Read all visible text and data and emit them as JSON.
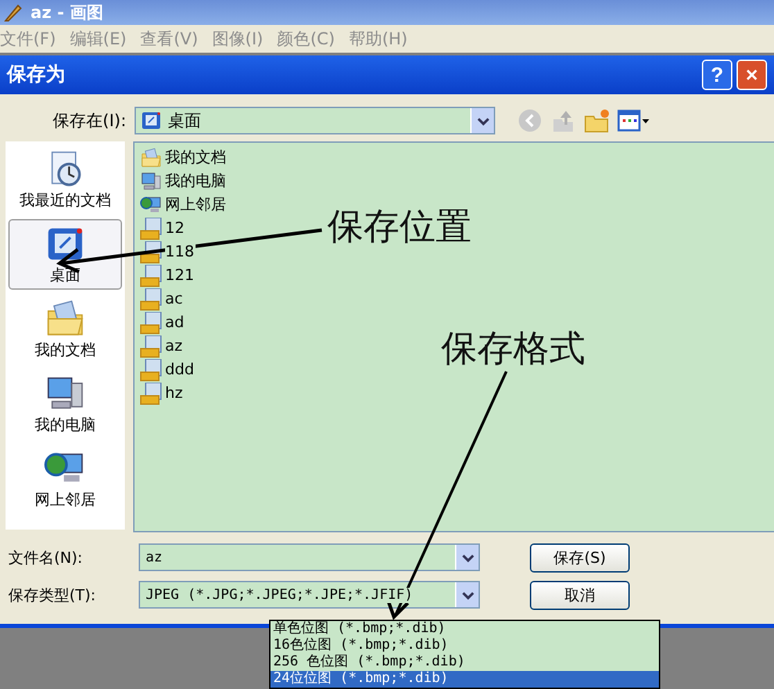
{
  "app_window": {
    "title": "az - 画图"
  },
  "menu": [
    {
      "label": "文件(F)",
      "disabled": true
    },
    {
      "label": "编辑(E)",
      "disabled": true
    },
    {
      "label": "查看(V)",
      "disabled": true
    },
    {
      "label": "图像(I)",
      "disabled": true
    },
    {
      "label": "颜色(C)",
      "disabled": true
    },
    {
      "label": "帮助(H)",
      "disabled": true
    }
  ],
  "dialog": {
    "title": "保存为",
    "help_button": "?",
    "close_button": "×"
  },
  "location": {
    "label": "保存在(I):",
    "value": "桌面"
  },
  "places": [
    {
      "kind": "recent",
      "label": "我最近的文档",
      "selected": false
    },
    {
      "kind": "desktop",
      "label": "桌面",
      "selected": true
    },
    {
      "kind": "documents",
      "label": "我的文档",
      "selected": false
    },
    {
      "kind": "computer",
      "label": "我的电脑",
      "selected": false
    },
    {
      "kind": "network",
      "label": "网上邻居",
      "selected": false
    }
  ],
  "files": [
    {
      "kind": "documents",
      "name": "我的文档"
    },
    {
      "kind": "computer",
      "name": "我的电脑"
    },
    {
      "kind": "network",
      "name": "网上邻居"
    },
    {
      "kind": "jpg",
      "name": "12"
    },
    {
      "kind": "jpg",
      "name": "118"
    },
    {
      "kind": "jpg",
      "name": "121"
    },
    {
      "kind": "jpg",
      "name": "ac"
    },
    {
      "kind": "jpg",
      "name": "ad"
    },
    {
      "kind": "jpg",
      "name": "az"
    },
    {
      "kind": "jpg",
      "name": "ddd"
    },
    {
      "kind": "jpg",
      "name": "hz"
    }
  ],
  "file_name": {
    "label": "文件名(N):",
    "value": "az"
  },
  "file_type": {
    "label": "保存类型(T):",
    "value": "JPEG (*.JPG;*.JPEG;*.JPE;*.JFIF)"
  },
  "buttons": [
    "保存(S)",
    "取消"
  ],
  "type_options": [
    {
      "label": "单色位图 (*.bmp;*.dib)",
      "selected": false
    },
    {
      "label": "16色位图 (*.bmp;*.dib)",
      "selected": false
    },
    {
      "label": "256 色位图 (*.bmp;*.dib)",
      "selected": false
    },
    {
      "label": "24位位图 (*.bmp;*.dib)",
      "selected": true
    }
  ],
  "annotations": [
    {
      "text": "保存位置"
    },
    {
      "text": "保存格式"
    }
  ]
}
